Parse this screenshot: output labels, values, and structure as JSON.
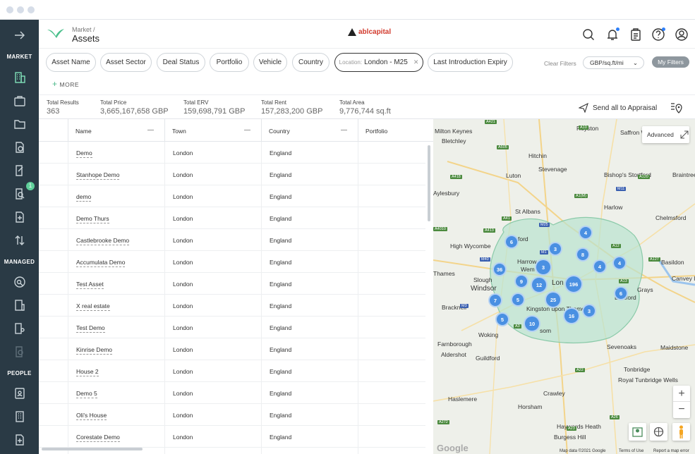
{
  "sidebar": {
    "sections": {
      "market": "MARKET",
      "managed": "MANAGED",
      "people": "PEOPLE"
    },
    "badge_count": "1",
    "icons": [
      "arrow-right-icon",
      "building-icon",
      "briefcase-icon",
      "folder-icon",
      "document-currency-icon",
      "document-edit-icon",
      "search-document-icon",
      "add-document-icon",
      "sort-arrows-icon",
      "search-user-icon",
      "building-chart-icon",
      "building-people-icon",
      "search-list-icon",
      "contact-book-icon",
      "office-building-icon",
      "add-file-icon"
    ]
  },
  "header": {
    "breadcrumb": "Market  /",
    "title": "Assets",
    "brand": "ablcapital",
    "icons": [
      "search-icon",
      "bell-icon",
      "clipboard-icon",
      "help-icon",
      "user-icon"
    ]
  },
  "filters": {
    "chips": [
      "Asset Name",
      "Asset Sector",
      "Deal Status",
      "Portfolio",
      "Vehicle",
      "Country"
    ],
    "location_label": "Location:",
    "location_value": "London - M25",
    "last_chip": "Last Introduction Expiry",
    "more": "MORE",
    "clear": "Clear Filters",
    "unit": "GBP/sq.ft/mi",
    "my_filters": "My Filters"
  },
  "totals": [
    {
      "label": "Total Results",
      "value": "363"
    },
    {
      "label": "Total Price",
      "value": "3,665,167,658 GBP"
    },
    {
      "label": "Total ERV",
      "value": "159,698,791 GBP"
    },
    {
      "label": "Total Rent",
      "value": "157,283,200 GBP"
    },
    {
      "label": "Total Area",
      "value": "9,776,744 sq.ft"
    }
  ],
  "send_appraisal": "Send all to Appraisal",
  "table": {
    "columns": [
      "Name",
      "Town",
      "Country",
      "Portfolio"
    ],
    "rows": [
      [
        "Demo",
        "London",
        "England"
      ],
      [
        "Stanhope Demo",
        "London",
        "England"
      ],
      [
        "demo",
        "London",
        "England"
      ],
      [
        "Demo Thurs",
        "London",
        "England"
      ],
      [
        "Castlebrooke Demo",
        "London",
        "England"
      ],
      [
        "Accumulata Demo",
        "London",
        "England"
      ],
      [
        "Test Asset",
        "London",
        "England"
      ],
      [
        "X real estate",
        "London",
        "England"
      ],
      [
        "Test Demo",
        "London",
        "England"
      ],
      [
        "Kinrise Demo",
        "London",
        "England"
      ],
      [
        "House 2",
        "London",
        "England"
      ],
      [
        "Demo 5",
        "London",
        "England"
      ],
      [
        "Oli's House",
        "London",
        "England"
      ],
      [
        "Corestate Demo",
        "London",
        "England"
      ]
    ]
  },
  "map": {
    "advanced": "Advanced",
    "places": [
      "Milton Keynes",
      "Bletchley",
      "Royston",
      "Saffron Walden",
      "Hitchin",
      "Stevenage",
      "Bishop's Stortford",
      "Braintree",
      "Luton",
      "Aylesbury",
      "Harlow",
      "St Albans",
      "Chelmsford",
      "High Wycombe",
      "ford",
      "Harrow",
      "Wem",
      "Basildon",
      "Thames",
      "Slough",
      "Windsor",
      "Lon",
      "Grays",
      "Canvey Isl",
      "Bracknell",
      "Kingston upon Thames",
      "Dartford",
      "Woking",
      "som",
      "Farnborough",
      "Aldershot",
      "Guildford",
      "Sevenoaks",
      "Maidstone",
      "Tonbridge",
      "Royal Tunbridge Wells",
      "Crawley",
      "Haslemere",
      "Horsham",
      "Haywards Heath",
      "Burgess Hill"
    ],
    "roads": [
      "A421",
      "A505",
      "A10",
      "A1(M)",
      "A120",
      "A418",
      "M11",
      "A41",
      "A12",
      "M25",
      "A4010",
      "A413",
      "M1",
      "A127",
      "M40",
      "A13",
      "M3",
      "A3",
      "A22",
      "A26",
      "A272",
      "A23"
    ],
    "clusters": [
      "6",
      "4",
      "3",
      "8",
      "36",
      "3",
      "4",
      "4",
      "9",
      "196",
      "12",
      "6",
      "7",
      "5",
      "25",
      "3",
      "5",
      "10",
      "16"
    ],
    "zoom_in": "+",
    "zoom_out": "−",
    "google": "Google",
    "attribution": [
      "Map data ©2021 Google",
      "Terms of Use",
      "Report a map error"
    ]
  }
}
